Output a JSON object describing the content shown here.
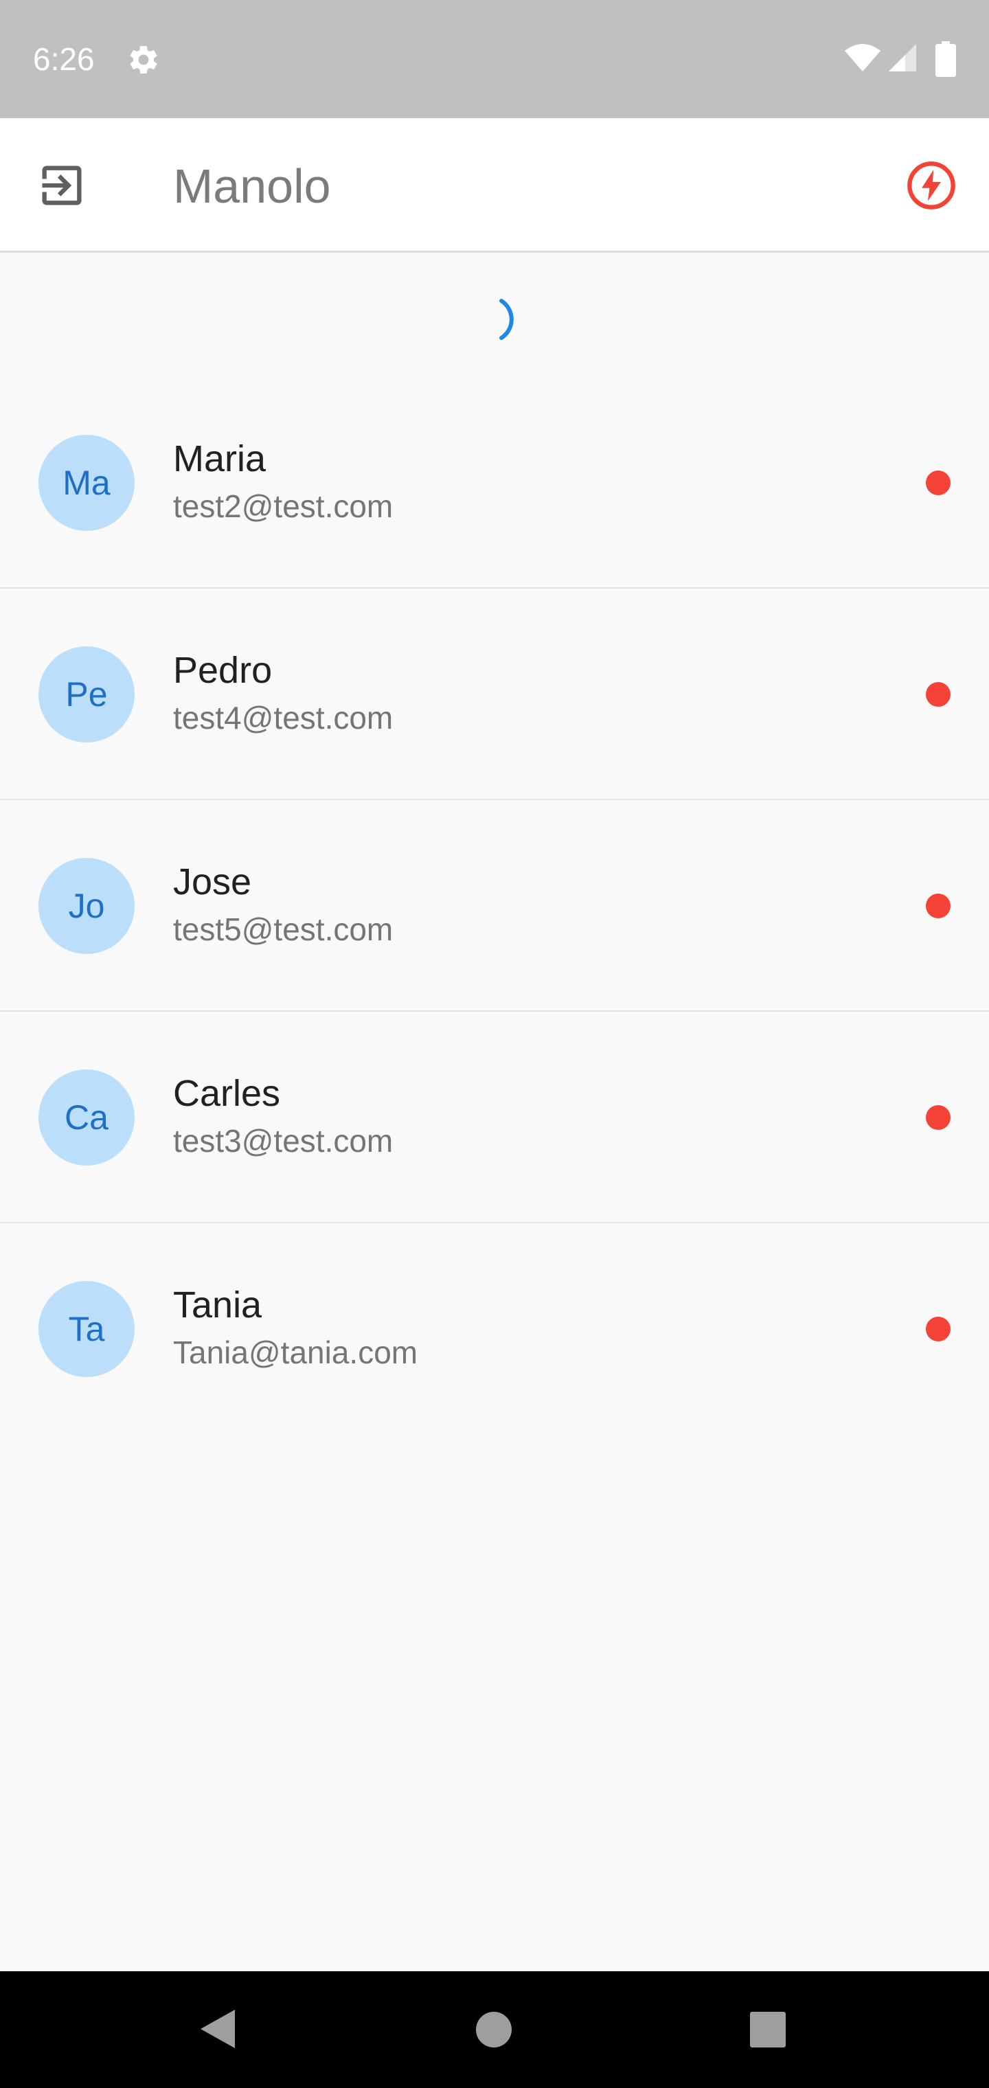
{
  "status_bar": {
    "time": "6:26",
    "icons": [
      "gear-icon",
      "wifi-icon",
      "signal-icon",
      "battery-icon"
    ]
  },
  "app_bar": {
    "title": "Manolo",
    "leading_icon": "logout-icon",
    "trailing_icon": "lightning-bolt-icon",
    "trailing_icon_color": "#f44336"
  },
  "loading_indicator": {
    "color": "#1e88e5"
  },
  "users": [
    {
      "initials": "Ma",
      "name": "Maria",
      "email": "test2@test.com",
      "online": false
    },
    {
      "initials": "Pe",
      "name": "Pedro",
      "email": "test4@test.com",
      "online": false
    },
    {
      "initials": "Jo",
      "name": "Jose",
      "email": "test5@test.com",
      "online": false
    },
    {
      "initials": "Ca",
      "name": "Carles",
      "email": "test3@test.com",
      "online": false
    },
    {
      "initials": "Ta",
      "name": "Tania",
      "email": "Tania@tania.com",
      "online": false
    }
  ],
  "colors": {
    "avatar_bg": "#bbdefb",
    "avatar_text": "#1e6fc6",
    "offline_dot": "#f44336"
  },
  "nav_bar": {
    "buttons": [
      "back-icon",
      "home-icon",
      "recents-icon"
    ]
  }
}
